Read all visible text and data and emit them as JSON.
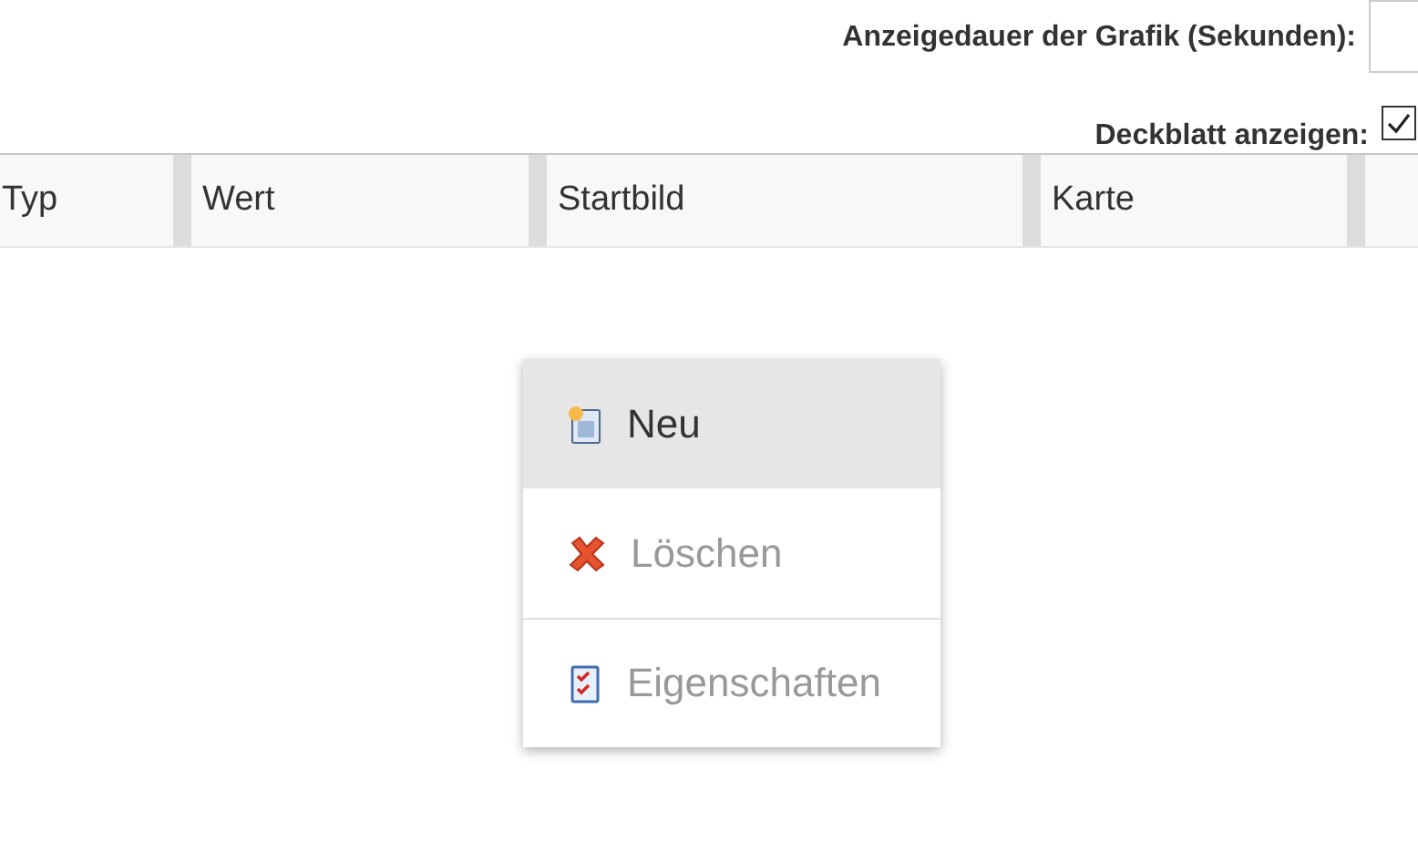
{
  "settings": {
    "duration_label": "Anzeigedauer der Grafik (Sekunden):",
    "cover_label": "Deckblatt anzeigen:",
    "cover_checked": true
  },
  "table": {
    "columns": [
      "Typ",
      "Wert",
      "Startbild",
      "Karte"
    ]
  },
  "context_menu": [
    {
      "label": "Neu",
      "kind": "new",
      "selected": true,
      "disabled": false,
      "separator_before": false
    },
    {
      "label": "Löschen",
      "kind": "delete",
      "selected": false,
      "disabled": true,
      "separator_before": false
    },
    {
      "label": "Eigenschaften",
      "kind": "properties",
      "selected": false,
      "disabled": true,
      "separator_before": true
    }
  ]
}
